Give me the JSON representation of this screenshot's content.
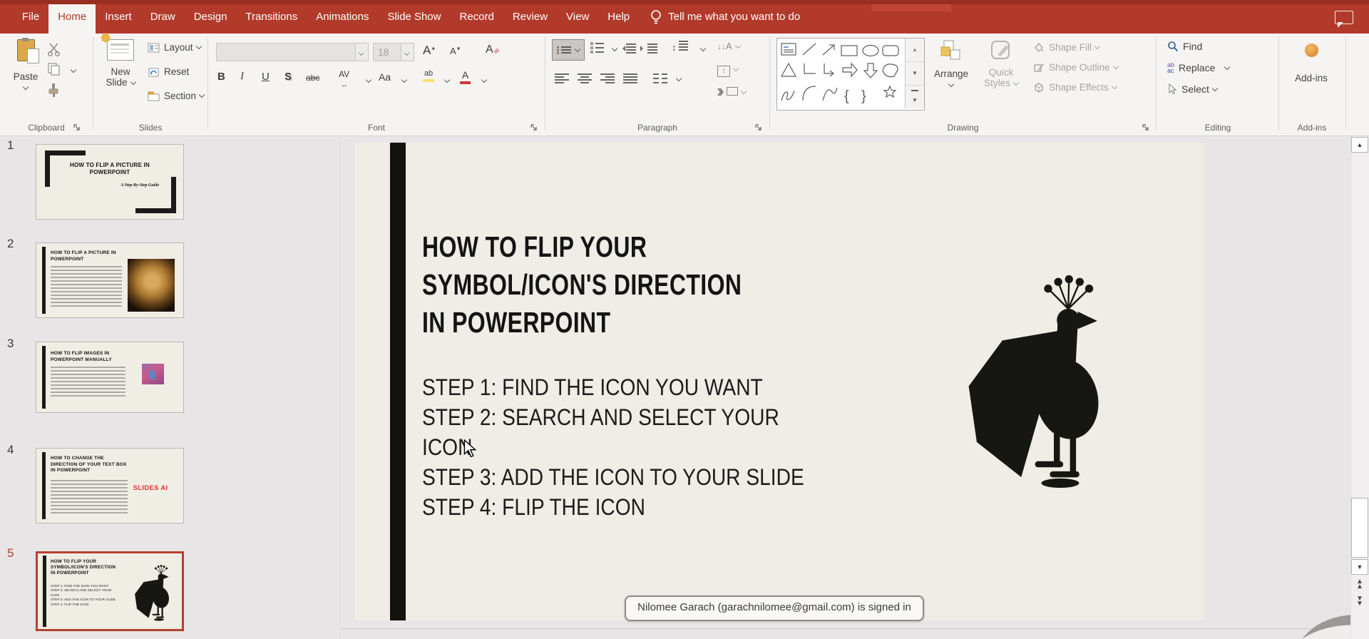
{
  "menubar": {
    "items": [
      "File",
      "Home",
      "Insert",
      "Draw",
      "Design",
      "Transitions",
      "Animations",
      "Slide Show",
      "Record",
      "Review",
      "View",
      "Help"
    ],
    "active": "Home",
    "tell_me": "Tell me what you want to do"
  },
  "ribbon": {
    "clipboard": {
      "group": "Clipboard",
      "paste": "Paste"
    },
    "slides": {
      "group": "Slides",
      "new_word1": "New",
      "new_word2": "Slide",
      "layout": "Layout",
      "reset": "Reset",
      "section": "Section"
    },
    "font": {
      "group": "Font",
      "size": "18",
      "bold": "B",
      "italic": "I",
      "underline": "U",
      "shadow": "S",
      "strike": "abc",
      "spacing": "AV",
      "case": "Aa",
      "highlight": "ab",
      "color": "A",
      "grow": "A",
      "shrink": "A",
      "clear": "A"
    },
    "paragraph": {
      "group": "Paragraph"
    },
    "drawing": {
      "group": "Drawing",
      "arrange": "Arrange",
      "quick_word1": "Quick",
      "quick_word2": "Styles",
      "fill": "Shape Fill",
      "outline": "Shape Outline",
      "effects": "Shape Effects"
    },
    "editing": {
      "group": "Editing",
      "find": "Find",
      "replace": "Replace",
      "select": "Select",
      "replace_ab": "ab",
      "replace_ac": "ac"
    },
    "addins": {
      "group": "Add-ins",
      "button": "Add-ins"
    }
  },
  "thumbnails": [
    {
      "num": "1",
      "title": "HOW TO FLIP A PICTURE IN POWERPOINT",
      "subtitle": "A Step-By-Step Guide"
    },
    {
      "num": "2",
      "title": "HOW TO FLIP A PICTURE IN POWERPOINT"
    },
    {
      "num": "3",
      "title": "HOW TO FLIP IMAGES IN POWERPOINT MANUALLY"
    },
    {
      "num": "4",
      "title": "HOW TO CHANGE THE DIRECTION OF YOUR TEXT BOX IN POWERPOINT",
      "accent": "SLIDES AI"
    },
    {
      "num": "5",
      "title": "HOW TO FLIP YOUR SYMBOL/ICON'S DIRECTION IN POWERPOINT",
      "lines": [
        "STEP 1: FIND THE ICON YOU WANT",
        "STEP 2: SEARCH AND SELECT YOUR",
        "ICON",
        "STEP 3: ADD THE ICON TO YOUR SLIDE",
        "STEP 4: FLIP THE ICON"
      ]
    }
  ],
  "slide": {
    "title_lines": [
      "HOW TO FLIP YOUR",
      "SYMBOL/ICON'S DIRECTION",
      "IN POWERPOINT"
    ],
    "step_lines": [
      "STEP 1: FIND THE ICON YOU WANT",
      "STEP 2: SEARCH AND SELECT YOUR",
      "ICON",
      "STEP 3: ADD THE ICON TO YOUR SLIDE",
      "STEP 4: FLIP THE ICON"
    ]
  },
  "tooltip": {
    "signed_in": "Nilomee Garach (garachnilomee@gmail.com) is signed in"
  },
  "icons": {
    "up": "▲",
    "down": "▼",
    "brace_l": "{",
    "brace_r": "}",
    "updown": "↕",
    "leftright": "↔",
    "down_arrow": "↓",
    "letter_a": "A"
  }
}
